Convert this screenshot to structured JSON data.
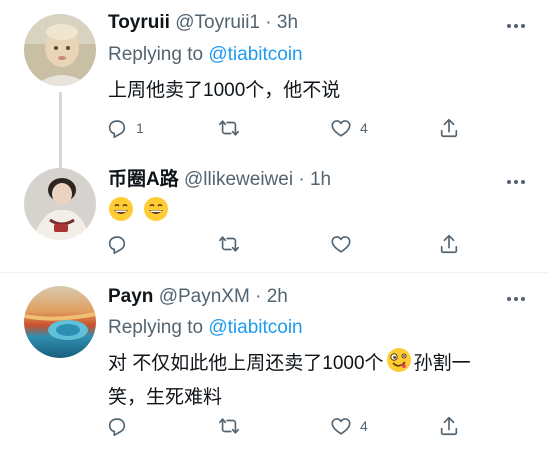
{
  "tweets": [
    {
      "name": "Toyruii",
      "handle": "@Toyruii1",
      "time": "3h",
      "replying_prefix": "Replying to",
      "replying_to": "@tiabitcoin",
      "text": "上周他卖了1000个，他不说",
      "reply_count": "1",
      "retweet_count": "",
      "like_count": "4"
    },
    {
      "name": "币圈A路",
      "handle": "@llikeweiwei",
      "time": "1h",
      "text": "",
      "reply_count": "",
      "retweet_count": "",
      "like_count": ""
    },
    {
      "name": "Payn",
      "handle": "@PaynXM",
      "time": "2h",
      "replying_prefix": "Replying to",
      "replying_to": "@tiabitcoin",
      "text_part1": "对 不仅如此他上周还卖了1000个",
      "text_part2": "孙割一",
      "text_line2": "笑，生死难料",
      "reply_count": "",
      "retweet_count": "",
      "like_count": "4"
    }
  ],
  "separator": "·",
  "colors": {
    "secondary_text": "#536471",
    "link": "#1d9bf0",
    "thread_line": "#cfd9de",
    "divider": "#eff3f4"
  }
}
